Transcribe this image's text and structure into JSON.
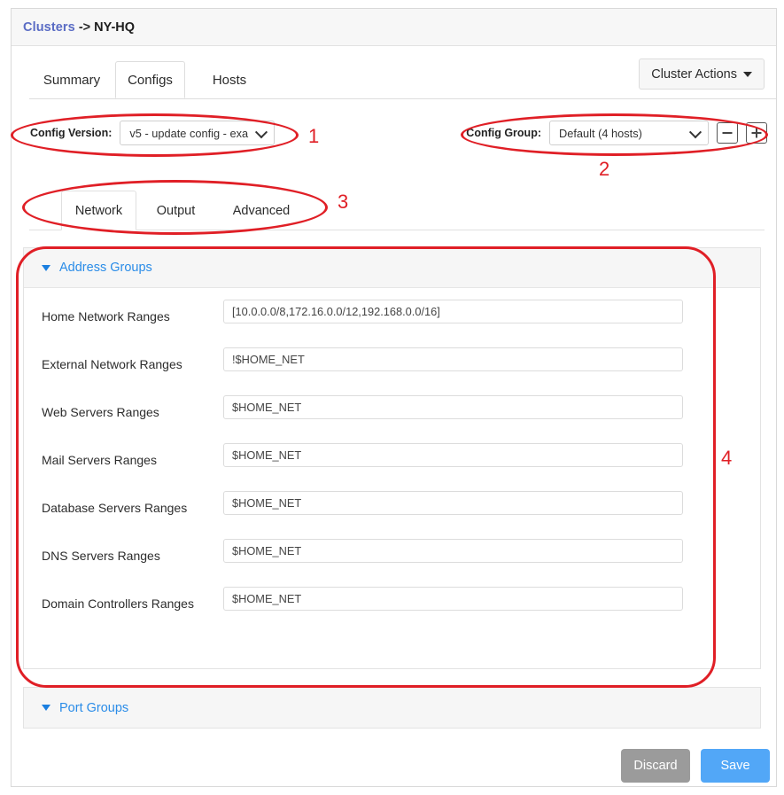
{
  "breadcrumb": {
    "root": "Clusters",
    "separator": "->",
    "current": "NY-HQ"
  },
  "tabs": [
    {
      "label": "Summary",
      "active": false
    },
    {
      "label": "Configs",
      "active": true
    },
    {
      "label": "Hosts",
      "active": false
    }
  ],
  "header": {
    "cluster_actions_label": "Cluster Actions"
  },
  "config_bar": {
    "version_label": "Config Version:",
    "version_value": "v5 - update config - exa",
    "group_label": "Config Group:",
    "group_value": "Default (4 hosts)",
    "remove_group_label": "−",
    "add_group_label": "+"
  },
  "subtabs": [
    {
      "label": "Network",
      "active": true
    },
    {
      "label": "Output",
      "active": false
    },
    {
      "label": "Advanced",
      "active": false
    }
  ],
  "address_groups": {
    "title": "Address Groups",
    "fields": [
      {
        "label": "Home Network Ranges",
        "value": "[10.0.0.0/8,172.16.0.0/12,192.168.0.0/16]"
      },
      {
        "label": "External Network Ranges",
        "value": "!$HOME_NET"
      },
      {
        "label": "Web Servers Ranges",
        "value": "$HOME_NET"
      },
      {
        "label": "Mail Servers Ranges",
        "value": "$HOME_NET"
      },
      {
        "label": "Database Servers Ranges",
        "value": "$HOME_NET"
      },
      {
        "label": "DNS Servers Ranges",
        "value": "$HOME_NET"
      },
      {
        "label": "Domain Controllers Ranges",
        "value": "$HOME_NET"
      }
    ]
  },
  "port_groups": {
    "title": "Port Groups"
  },
  "footer": {
    "discard_label": "Discard",
    "save_label": "Save"
  },
  "annotations": [
    {
      "number": "1"
    },
    {
      "number": "2"
    },
    {
      "number": "3"
    },
    {
      "number": "4"
    }
  ],
  "colors": {
    "link": "#5a6cc4",
    "card_title": "#2a8ce8",
    "save": "#52a7f7",
    "discard": "#9b9b9b",
    "annotation": "#e01f26"
  }
}
